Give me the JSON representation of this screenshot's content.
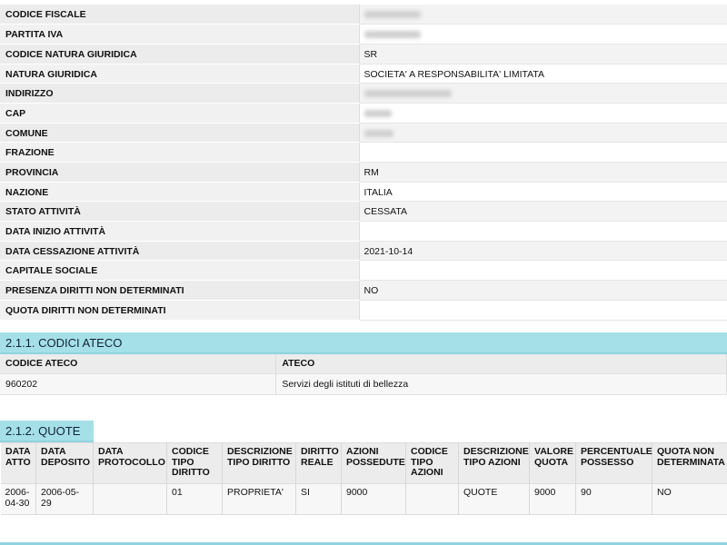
{
  "anagrafica": {
    "rows": [
      {
        "label": "CODICE FISCALE",
        "value": "",
        "redacted": true
      },
      {
        "label": "PARTITA IVA",
        "value": "",
        "redacted": true
      },
      {
        "label": "CODICE NATURA GIURIDICA",
        "value": "SR",
        "redacted": false
      },
      {
        "label": "NATURA GIURIDICA",
        "value": "SOCIETA' A RESPONSABILITA' LIMITATA",
        "redacted": false
      },
      {
        "label": "INDIRIZZO",
        "value": "",
        "redacted": true
      },
      {
        "label": "CAP",
        "value": "",
        "redacted": true
      },
      {
        "label": "COMUNE",
        "value": "",
        "redacted": true
      },
      {
        "label": "FRAZIONE",
        "value": "",
        "redacted": false
      },
      {
        "label": "PROVINCIA",
        "value": "RM",
        "redacted": false
      },
      {
        "label": "NAZIONE",
        "value": "ITALIA",
        "redacted": false
      },
      {
        "label": "STATO ATTIVITÀ",
        "value": "CESSATA",
        "redacted": false
      },
      {
        "label": "DATA INIZIO ATTIVITÀ",
        "value": "",
        "redacted": false
      },
      {
        "label": "DATA CESSAZIONE ATTIVITÀ",
        "value": "2021-10-14",
        "redacted": false
      },
      {
        "label": "CAPITALE SOCIALE",
        "value": "",
        "redacted": false
      },
      {
        "label": "PRESENZA DIRITTI NON DETERMINATI",
        "value": "NO",
        "redacted": false
      },
      {
        "label": "QUOTA DIRITTI NON DETERMINATI",
        "value": "",
        "redacted": false
      }
    ]
  },
  "ateco_section": {
    "title": "2.1.1. CODICI ATECO",
    "headers": [
      "CODICE ATECO",
      "ATECO"
    ],
    "rows": [
      [
        "960202",
        "Servizi degli istituti di bellezza"
      ]
    ]
  },
  "quote_section": {
    "title": "2.1.2. QUOTE",
    "headers": [
      "DATA ATTO",
      "DATA DEPOSITO",
      "DATA PROTOCOLLO",
      "CODICE TIPO DIRITTO",
      "DESCRIZIONE TIPO DIRITTO",
      "DIRITTO REALE",
      "AZIONI POSSEDUTE",
      "CODICE TIPO AZIONI",
      "DESCRIZIONE TIPO AZIONI",
      "VALORE QUOTA",
      "PERCENTUALE POSSESSO",
      "QUOTA NON DETERMINATA"
    ],
    "rows": [
      [
        "2006-04-30",
        "2006-05-29",
        "",
        "01",
        "PROPRIETA'",
        "SI",
        "9000",
        "",
        "QUOTE",
        "9000",
        "90",
        "NO"
      ]
    ]
  },
  "colors": {
    "section_header_bg": "#a5e0e8",
    "label_bg": "#ececec"
  }
}
